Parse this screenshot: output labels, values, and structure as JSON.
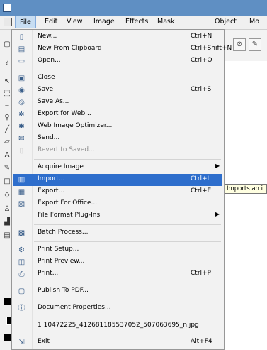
{
  "menubar": {
    "items": [
      "File",
      "Edit",
      "View",
      "Image",
      "Effects",
      "Mask",
      "Object",
      "Mo"
    ]
  },
  "file_menu": {
    "items": [
      {
        "label": "New...",
        "shortcut": "Ctrl+N",
        "icon": "new-document-icon"
      },
      {
        "label": "New From Clipboard",
        "shortcut": "Ctrl+Shift+N",
        "icon": "clipboard-icon"
      },
      {
        "label": "Open...",
        "shortcut": "Ctrl+O",
        "icon": "open-folder-icon"
      },
      {
        "label": "Close",
        "shortcut": "",
        "icon": "close-document-icon"
      },
      {
        "label": "Save",
        "shortcut": "Ctrl+S",
        "icon": "save-icon"
      },
      {
        "label": "Save As...",
        "shortcut": "",
        "icon": "save-as-icon"
      },
      {
        "label": "Export for Web...",
        "shortcut": "",
        "icon": "web-export-icon"
      },
      {
        "label": "Web Image Optimizer...",
        "shortcut": "",
        "icon": "optimizer-icon"
      },
      {
        "label": "Send...",
        "shortcut": "",
        "icon": "send-icon"
      },
      {
        "label": "Revert to Saved...",
        "shortcut": "",
        "icon": "revert-icon"
      },
      {
        "label": "Acquire Image",
        "shortcut": "",
        "icon": ""
      },
      {
        "label": "Import...",
        "shortcut": "Ctrl+I",
        "icon": "import-icon"
      },
      {
        "label": "Export...",
        "shortcut": "Ctrl+E",
        "icon": "export-icon"
      },
      {
        "label": "Export For Office...",
        "shortcut": "",
        "icon": "office-export-icon"
      },
      {
        "label": "File Format Plug-Ins",
        "shortcut": "",
        "icon": ""
      },
      {
        "label": "Batch Process...",
        "shortcut": "",
        "icon": "batch-icon"
      },
      {
        "label": "Print Setup...",
        "shortcut": "",
        "icon": "print-setup-icon"
      },
      {
        "label": "Print Preview...",
        "shortcut": "",
        "icon": "print-preview-icon"
      },
      {
        "label": "Print...",
        "shortcut": "Ctrl+P",
        "icon": "printer-icon"
      },
      {
        "label": "Publish To PDF...",
        "shortcut": "",
        "icon": "pdf-icon"
      },
      {
        "label": "Document Properties...",
        "shortcut": "",
        "icon": "info-icon"
      },
      {
        "label": "1 10472225_412681185537052_507063695_n.jpg",
        "shortcut": "",
        "icon": ""
      },
      {
        "label": "Exit",
        "shortcut": "Alt+F4",
        "icon": "exit-icon"
      }
    ]
  },
  "tooltip": "Imports an i"
}
